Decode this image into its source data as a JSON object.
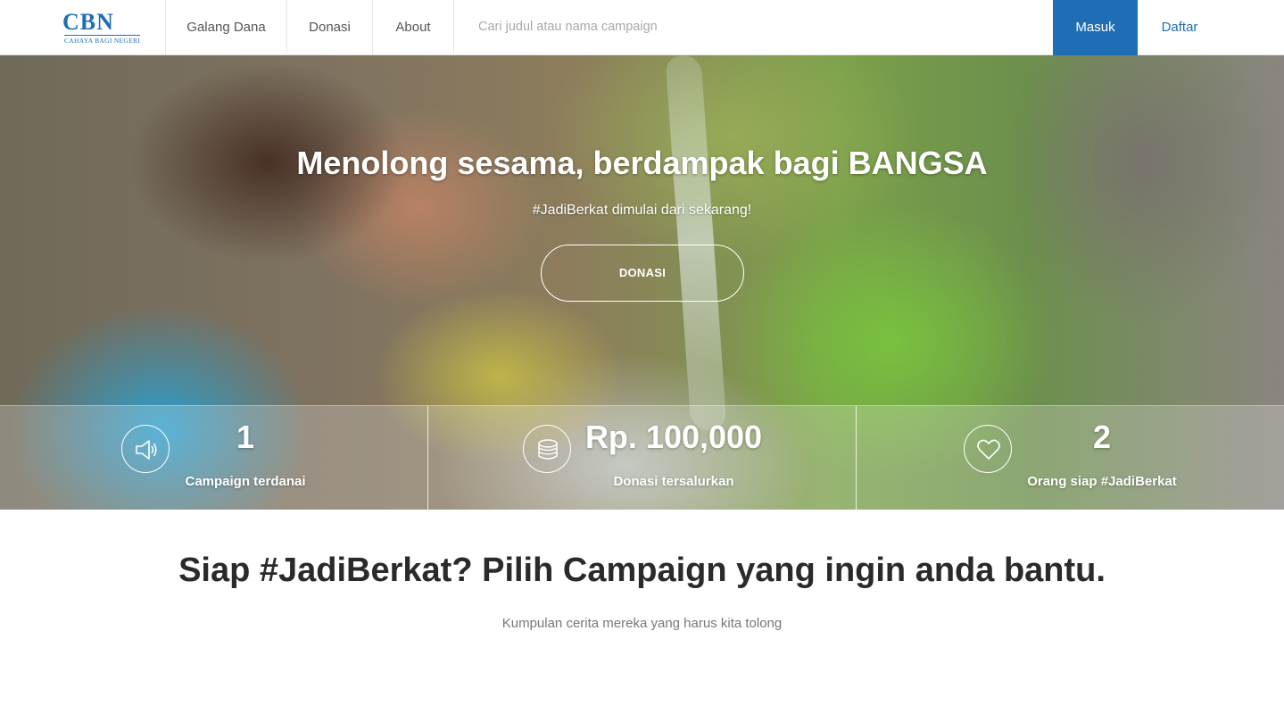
{
  "brand": {
    "logo_text": "CBN",
    "logo_subtext": "CAHAYA BAGI NEGERI",
    "accent_color": "#1f6db4"
  },
  "nav": {
    "links": [
      "Galang Dana",
      "Donasi",
      "About"
    ],
    "search_placeholder": "Cari judul atau nama campaign",
    "login_label": "Masuk",
    "register_label": "Daftar"
  },
  "hero": {
    "title": "Menolong sesama, berdampak bagi BANGSA",
    "subtitle": "#JadiBerkat dimulai dari sekarang!",
    "cta_label": "DONASI"
  },
  "stats": [
    {
      "icon": "speaker-icon",
      "value": "1",
      "label": "Campaign terdanai"
    },
    {
      "icon": "coins-icon",
      "value": "Rp. 100,000",
      "label": "Donasi tersalurkan"
    },
    {
      "icon": "heart-icon",
      "value": "2",
      "label": "Orang siap #JadiBerkat"
    }
  ],
  "section": {
    "title": "Siap #JadiBerkat? Pilih Campaign yang ingin anda bantu.",
    "subtitle": "Kumpulan cerita mereka yang harus kita tolong"
  }
}
